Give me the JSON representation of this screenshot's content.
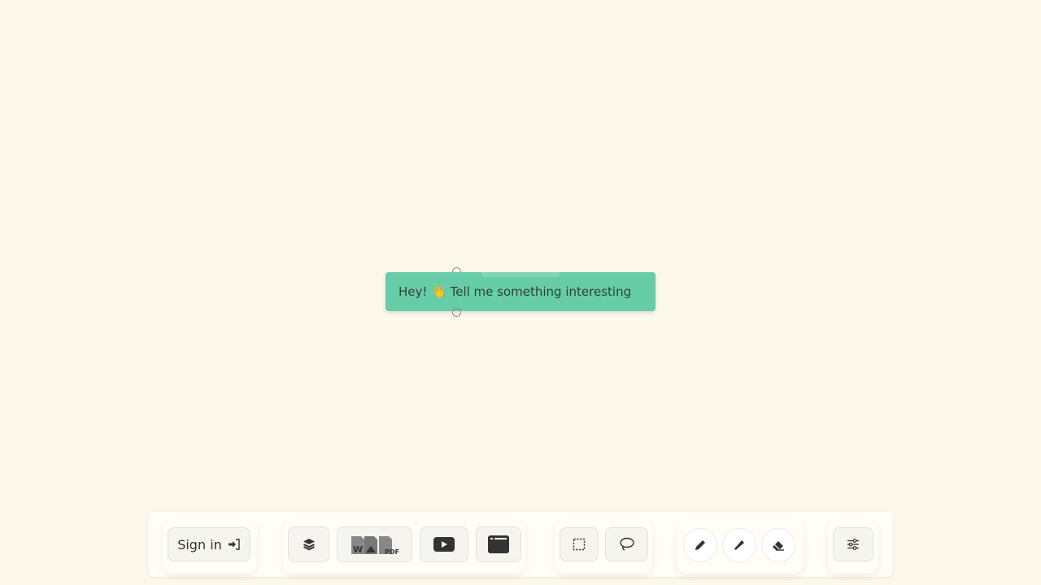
{
  "canvas": {
    "background": "#fdf9ea"
  },
  "node": {
    "text": "Hey! 👋 Tell me something interesting",
    "color": "#66cda8"
  },
  "toolbar": {
    "signin_label": "Sign in",
    "signin_icon": "sign-in-icon",
    "buttons": [
      {
        "name": "layers",
        "icon": "layers-icon"
      },
      {
        "name": "import-files",
        "icon": "file-types-icon",
        "badge": "PDF",
        "word_badge": "W"
      },
      {
        "name": "youtube",
        "icon": "play-icon"
      },
      {
        "name": "browser",
        "icon": "browser-window-icon"
      },
      {
        "name": "rectangle-select",
        "icon": "dashed-rectangle-icon"
      },
      {
        "name": "lasso-select",
        "icon": "lasso-icon"
      },
      {
        "name": "pen",
        "icon": "pencil-icon"
      },
      {
        "name": "highlighter",
        "icon": "marker-icon"
      },
      {
        "name": "eraser",
        "icon": "eraser-icon"
      },
      {
        "name": "settings",
        "icon": "sliders-icon"
      }
    ]
  }
}
